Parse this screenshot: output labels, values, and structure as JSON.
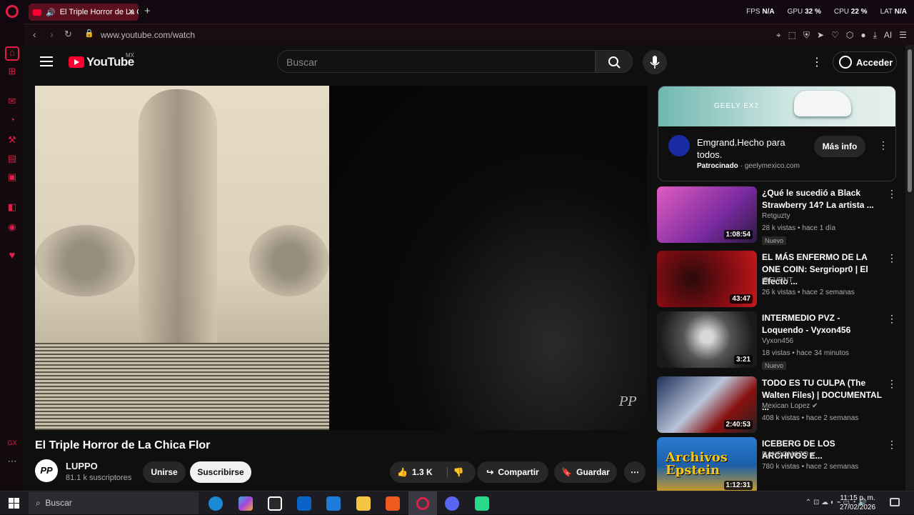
{
  "browser": {
    "tab_title": "El Triple Horror de La C",
    "url": "www.youtube.com/watch",
    "stats": [
      {
        "label": "FPS",
        "value": "N/A"
      },
      {
        "label": "GPU",
        "value": "32 %"
      },
      {
        "label": "CPU",
        "value": "22 %"
      },
      {
        "label": "LAT",
        "value": "N/A"
      }
    ],
    "ai_label": "AI"
  },
  "youtube": {
    "logo_text": "YouTube",
    "region": "MX",
    "search_placeholder": "Buscar",
    "signin_label": "Acceder"
  },
  "video": {
    "title": "El Triple Horror de La Chica Flor",
    "watermark": "PP",
    "channel": {
      "avatar_text": "PP",
      "name": "LUPPO",
      "subscribers": "81.1 k suscriptores"
    },
    "join_label": "Unirse",
    "subscribe_label": "Suscribirse",
    "likes": "1.3 K",
    "share_label": "Compartir",
    "save_label": "Guardar"
  },
  "ad": {
    "banner_brand": "GEELY EX2",
    "title": "Emgrand.Hecho para todos.",
    "sponsored_label": "Patrocinado",
    "domain": "geelymexico.com",
    "cta": "Más info"
  },
  "recommendations": [
    {
      "title": "¿Qué le sucedió a Black Strawberry 14? La artista ...",
      "channel": "Retguzty",
      "verified": false,
      "views": "28 k vistas",
      "age": "hace 1 día",
      "duration": "1:08:54",
      "badge": "Nuevo",
      "thumb_color": "#d14fb0"
    },
    {
      "title": "EL MÁS ENFERMO DE LA ONE COIN: Sergriopr0 | El Efecto ...",
      "channel": "iREVRNT",
      "verified": false,
      "views": "26 k vistas",
      "age": "hace 2 semanas",
      "duration": "43:47",
      "badge": "",
      "thumb_color": "#8a0d14"
    },
    {
      "title": "INTERMEDIO PVZ - Loquendo - Vyxon456",
      "channel": "Vyxon456",
      "verified": false,
      "views": "18 vistas",
      "age": "hace 34 minutos",
      "duration": "3:21",
      "badge": "Nuevo",
      "thumb_color": "#3a3a3a"
    },
    {
      "title": "TODO ES TU CULPA (The Walten Files) | DOCUMENTAL ...",
      "channel": "Mexican Lopez",
      "verified": true,
      "views": "408 k vistas",
      "age": "hace 2 semanas",
      "duration": "2:40:53",
      "badge": "",
      "thumb_color": "#1e2f5a"
    },
    {
      "title": "ICEBERG DE LOS ARCHIVOS E...",
      "channel": "RANDOMAZO",
      "verified": true,
      "views": "780 k vistas",
      "age": "hace 2 semanas",
      "duration": "1:12:31",
      "badge": "",
      "thumb_color": "#1c5fa8",
      "thumb_text": "Archivos Epstein"
    }
  ],
  "taskbar": {
    "search_placeholder": "Buscar",
    "time": "11:15 p. m.",
    "date": "27/02/2026"
  }
}
